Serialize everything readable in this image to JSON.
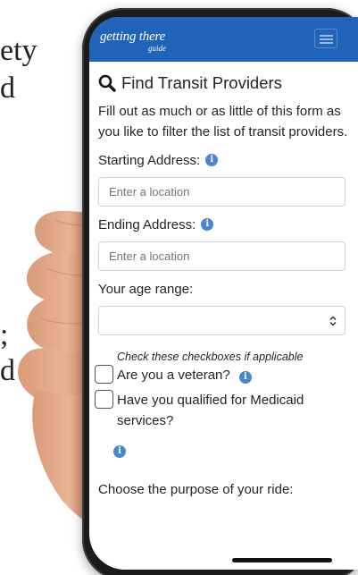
{
  "background": {
    "fragments": [
      "ety",
      "d",
      ";",
      "d"
    ]
  },
  "header": {
    "logo_main": "getting there",
    "logo_sub": "guide",
    "menu_icon": "hamburger-menu-icon",
    "bar_color": "#1f64b8"
  },
  "form": {
    "title": "Find Transit Providers",
    "title_icon": "search-icon",
    "intro": "Fill out as much or as little of this form as you like to filter the list of transit providers.",
    "starting_address": {
      "label": "Starting Address:",
      "placeholder": "Enter a location",
      "value": ""
    },
    "ending_address": {
      "label": "Ending Address:",
      "placeholder": "Enter a location",
      "value": ""
    },
    "age_range": {
      "label": "Your age range:",
      "selected": ""
    },
    "checkbox_hint": "Check these checkboxes if applicable",
    "veteran": {
      "label": "Are you a veteran?",
      "checked": false
    },
    "medicaid": {
      "label": "Have you qualified for Medicaid services?",
      "checked": false
    },
    "purpose_label": "Choose the purpose of your ride:",
    "info_icon_color": "#4a86cf"
  }
}
